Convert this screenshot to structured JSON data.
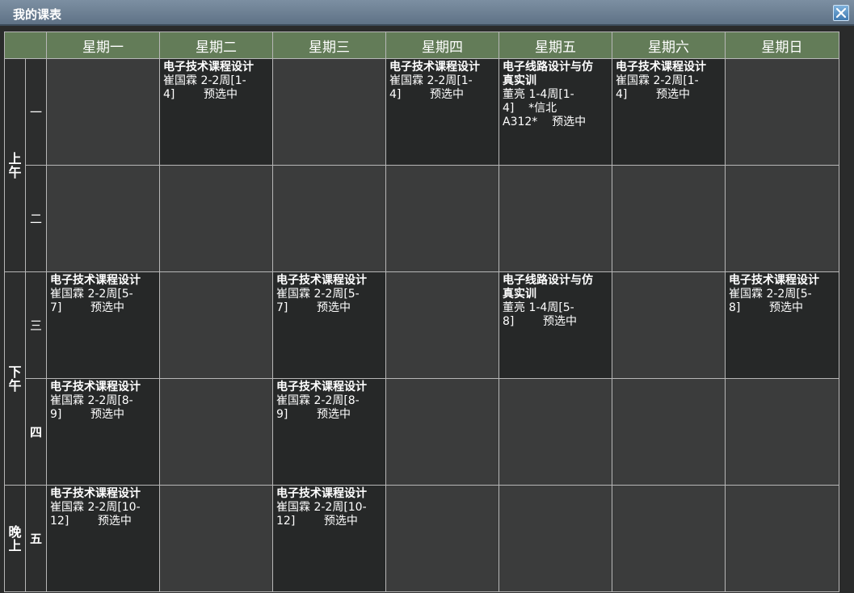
{
  "window": {
    "title": "我的课表"
  },
  "days": [
    "星期一",
    "星期二",
    "星期三",
    "星期四",
    "星期五",
    "星期六",
    "星期日"
  ],
  "groups": [
    {
      "label": "上\n午"
    },
    {
      "label": "下\n午"
    },
    {
      "label": "晚\n上"
    }
  ],
  "periods": [
    "一",
    "二",
    "三",
    "四",
    "五"
  ],
  "cells": {
    "p1": {
      "d2": {
        "title": "电子技术课程设计",
        "info": "崔国霖 2-2周[1-\n4]        预选中"
      },
      "d4": {
        "title": "电子技术课程设计",
        "info": "崔国霖 2-2周[1-\n4]        预选中"
      },
      "d5": {
        "title": "电子线路设计与仿\n真实训",
        "info": "董亮 1-4周[1-\n4]    *信北\nA312*    预选中"
      },
      "d6": {
        "title": "电子技术课程设计",
        "info": "崔国霖 2-2周[1-\n4]        预选中"
      }
    },
    "p3": {
      "d1": {
        "title": "电子技术课程设计",
        "info": "崔国霖 2-2周[5-\n7]        预选中"
      },
      "d3": {
        "title": "电子技术课程设计",
        "info": "崔国霖 2-2周[5-\n7]        预选中"
      },
      "d5": {
        "title": "电子线路设计与仿\n真实训",
        "info": "董亮 1-4周[5-\n8]        预选中"
      },
      "d7": {
        "title": "电子技术课程设计",
        "info": "崔国霖 2-2周[5-\n8]        预选中"
      }
    },
    "p4": {
      "d1": {
        "title": "电子技术课程设计",
        "info": "崔国霖 2-2周[8-\n9]        预选中"
      },
      "d3": {
        "title": "电子技术课程设计",
        "info": "崔国霖 2-2周[8-\n9]        预选中"
      }
    },
    "p5": {
      "d1": {
        "title": "电子技术课程设计",
        "info": "崔国霖 2-2周[10-\n12]        预选中"
      },
      "d3": {
        "title": "电子技术课程设计",
        "info": "崔国霖 2-2周[10-\n12]        预选中"
      }
    }
  },
  "colors": {
    "header_bg": "#637c58",
    "cell_empty": "#3b3c3c",
    "cell_filled": "#262828",
    "titlebar": "#6d8095"
  }
}
